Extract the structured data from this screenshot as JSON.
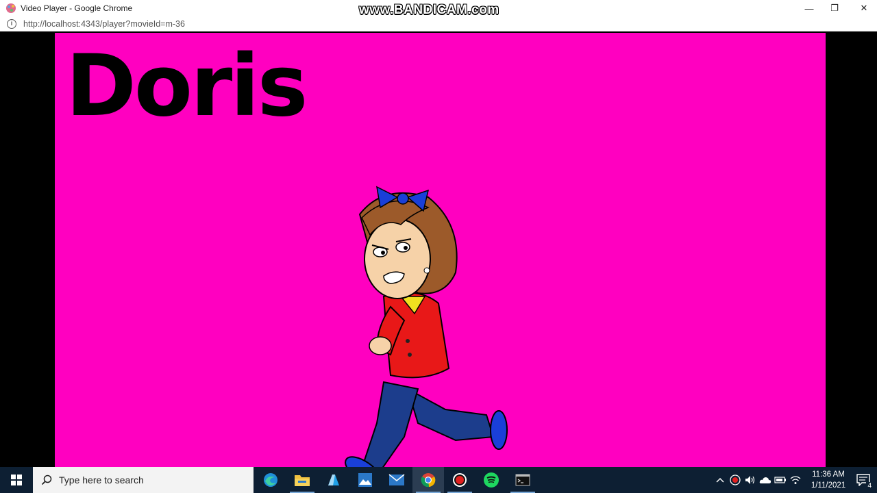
{
  "window": {
    "title": "Video Player - Google Chrome",
    "watermark": "www.BANDICAM.com",
    "controls": {
      "minimize": "—",
      "maximize": "❐",
      "close": "✕"
    }
  },
  "address": {
    "url_prefix": "http://",
    "url_host": "localhost",
    "url_rest": ":4343/player?movieId=m-36"
  },
  "video": {
    "caption": "Doris",
    "background": "#ff00c0"
  },
  "taskbar": {
    "search_placeholder": "Type here to search",
    "apps": [
      "edge-icon",
      "file-explorer-icon",
      "azure-icon",
      "photos-icon",
      "mail-icon",
      "chrome-icon",
      "bandicam-icon",
      "spotify-icon",
      "terminal-icon"
    ],
    "time": "11:36 AM",
    "date": "1/11/2021",
    "notification_count": "4"
  }
}
